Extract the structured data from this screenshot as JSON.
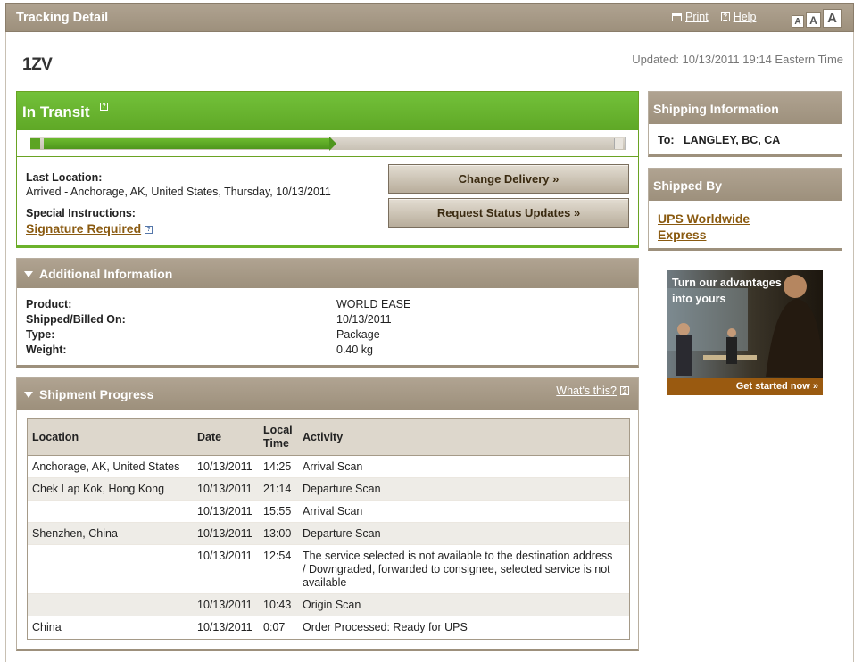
{
  "header": {
    "title": "Tracking Detail",
    "print_label": "Print",
    "help_label": "Help",
    "font_sizes": [
      "A",
      "A",
      "A"
    ]
  },
  "tracking_number": "1ZV",
  "updated": "Updated: 10/13/2011 19:14 Eastern Time",
  "status": {
    "label": "In Transit",
    "progress_fraction": 0.5,
    "last_location_label": "Last Location:",
    "last_location_value": "Arrived - Anchorage, AK, United States, Thursday, 10/13/2011",
    "special_instructions_label": "Special Instructions:",
    "signature_required": "Signature Required",
    "change_delivery": "Change Delivery »",
    "request_updates": "Request Status Updates »"
  },
  "additional_info": {
    "title": "Additional Information",
    "rows": [
      {
        "key": "Product:",
        "value": "WORLD EASE"
      },
      {
        "key": "Shipped/Billed On:",
        "value": "10/13/2011"
      },
      {
        "key": "Type:",
        "value": "Package"
      },
      {
        "key": "Weight:",
        "value": "0.40 kg"
      }
    ]
  },
  "shipment_progress": {
    "title": "Shipment Progress",
    "whats_this": "What's this?",
    "columns": {
      "location": "Location",
      "date": "Date",
      "local_time_1": "Local",
      "local_time_2": "Time",
      "activity": "Activity"
    },
    "rows": [
      {
        "location": "Anchorage, AK, United States",
        "date": "10/13/2011",
        "time": "14:25",
        "activity": "Arrival Scan"
      },
      {
        "location": "Chek Lap Kok, Hong Kong",
        "date": "10/13/2011",
        "time": "21:14",
        "activity": "Departure Scan"
      },
      {
        "location": "",
        "date": "10/13/2011",
        "time": "15:55",
        "activity": "Arrival Scan"
      },
      {
        "location": "Shenzhen, China",
        "date": "10/13/2011",
        "time": "13:00",
        "activity": "Departure Scan"
      },
      {
        "location": "",
        "date": "10/13/2011",
        "time": "12:54",
        "activity": "The service selected is not available to the destination address / Downgraded, forwarded to consignee, selected service is not available"
      },
      {
        "location": "",
        "date": "10/13/2011",
        "time": "10:43",
        "activity": "Origin Scan"
      },
      {
        "location": "China",
        "date": "10/13/2011",
        "time": "0:07",
        "activity": "Order Processed: Ready for UPS"
      }
    ]
  },
  "shipping_info": {
    "title": "Shipping Information",
    "to_label": "To:",
    "to_value": "LANGLEY, BC, CA"
  },
  "shipped_by": {
    "title": "Shipped By",
    "service": "UPS Worldwide Express"
  },
  "ad": {
    "headline": "Turn our advantages into yours",
    "cta": "Get started now »"
  }
}
